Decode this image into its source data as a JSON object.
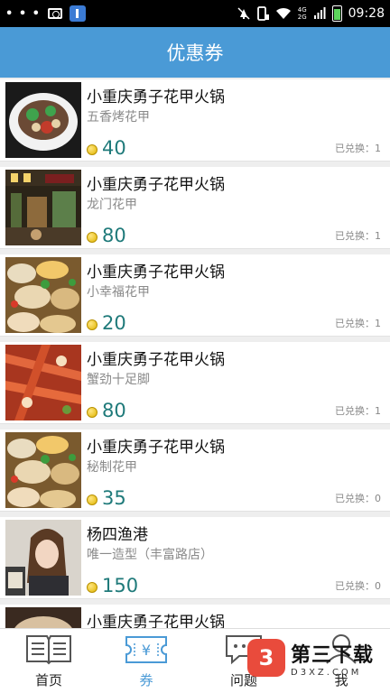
{
  "status_bar": {
    "left_dots": "• • •",
    "network": [
      "4G",
      "2G"
    ],
    "time": "09:28"
  },
  "header": {
    "title": "优惠券"
  },
  "coupons": [
    {
      "shop": "小重庆勇子花甲火锅",
      "dish": "五香烤花甲",
      "price": "40",
      "redeemed": "已兑换：1",
      "image": "clam-plate"
    },
    {
      "shop": "小重庆勇子花甲火锅",
      "dish": "龙门花甲",
      "price": "80",
      "redeemed": "已兑换：1",
      "image": "restaurant-interior"
    },
    {
      "shop": "小重庆勇子花甲火锅",
      "dish": "小幸福花甲",
      "price": "20",
      "redeemed": "已兑换：1",
      "image": "clam-pile"
    },
    {
      "shop": "小重庆勇子花甲火锅",
      "dish": "蟹劲十足脚",
      "price": "80",
      "redeemed": "已兑换：1",
      "image": "crab-legs"
    },
    {
      "shop": "小重庆勇子花甲火锅",
      "dish": "秘制花甲",
      "price": "35",
      "redeemed": "已兑换：0",
      "image": "clam-pile"
    },
    {
      "shop": "杨四渔港",
      "dish": "唯一造型（丰富路店）",
      "price": "150",
      "redeemed": "已兑换：0",
      "image": "woman-portrait"
    },
    {
      "shop": "小重庆勇子花甲火锅",
      "dish": "",
      "price": "",
      "redeemed": "",
      "image": "clam-plate"
    }
  ],
  "tabs": [
    {
      "label": "首页",
      "icon": "book-icon",
      "active": false
    },
    {
      "label": "券",
      "icon": "ticket-icon",
      "active": true
    },
    {
      "label": "问题",
      "icon": "chat-icon",
      "active": false
    },
    {
      "label": "我",
      "icon": "person-icon",
      "active": false
    }
  ],
  "watermark": {
    "main": "第三下载",
    "sub": "D3XZ.COM",
    "logo": "3"
  },
  "colors": {
    "title_bar": "#4a9ad6",
    "price": "#1f7a7a",
    "active_tab": "#4a9ad6"
  }
}
